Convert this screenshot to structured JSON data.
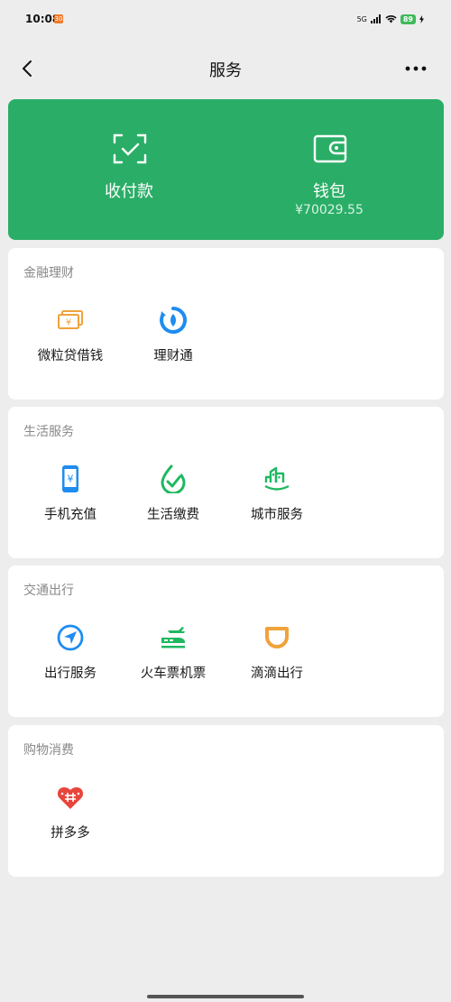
{
  "status": {
    "time": "10:08",
    "notif_badge": "30",
    "network": "5G",
    "battery": "89"
  },
  "nav": {
    "title": "服务"
  },
  "banner": {
    "pay_label": "收付款",
    "wallet_label": "钱包",
    "wallet_balance": "¥70029.55"
  },
  "sections": [
    {
      "title": "金融理财",
      "items": [
        {
          "label": "微粒贷借钱",
          "icon": "cash-notes-icon"
        },
        {
          "label": "理财通",
          "icon": "licaitong-icon"
        }
      ]
    },
    {
      "title": "生活服务",
      "items": [
        {
          "label": "手机充值",
          "icon": "phone-recharge-icon"
        },
        {
          "label": "生活缴费",
          "icon": "utility-payment-icon"
        },
        {
          "label": "城市服务",
          "icon": "city-service-icon"
        }
      ]
    },
    {
      "title": "交通出行",
      "items": [
        {
          "label": "出行服务",
          "icon": "navigation-icon"
        },
        {
          "label": "火车票机票",
          "icon": "train-plane-icon"
        },
        {
          "label": "滴滴出行",
          "icon": "didi-icon"
        }
      ]
    },
    {
      "title": "购物消费",
      "items": [
        {
          "label": "拼多多",
          "icon": "pinduoduo-icon"
        }
      ]
    }
  ],
  "colors": {
    "brand_green": "#2aae67",
    "orange": "#f0a23b",
    "blue": "#1f8cf0",
    "green": "#1fb861",
    "red": "#e8453c"
  }
}
